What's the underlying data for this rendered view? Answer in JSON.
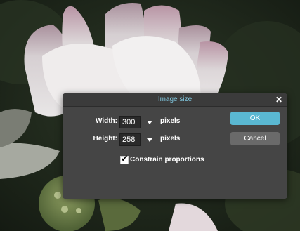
{
  "dialog": {
    "title": "Image size",
    "close_icon": "close-icon",
    "width": {
      "label": "Width:",
      "value": "300",
      "unit": "pixels"
    },
    "height": {
      "label": "Height:",
      "value": "258",
      "unit": "pixels"
    },
    "constrain": {
      "label": "Constrain proportions",
      "checked": true
    },
    "ok_label": "OK",
    "cancel_label": "Cancel"
  },
  "colors": {
    "title_text": "#7fc6de",
    "ok_button": "#5ab8d2",
    "cancel_button": "#6a6a6a",
    "dialog_bg": "#454545"
  }
}
